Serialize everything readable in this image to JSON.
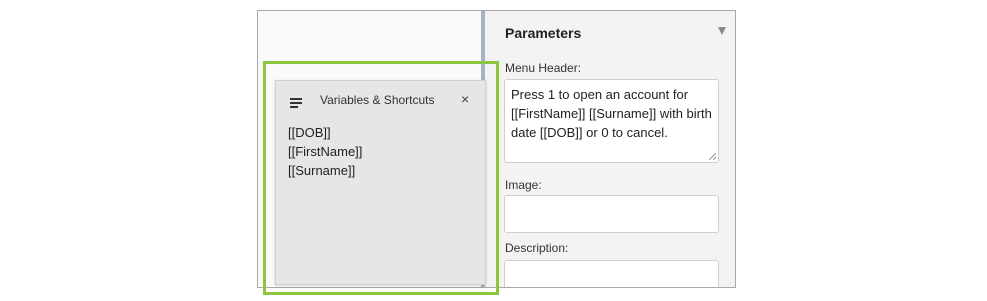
{
  "parameters": {
    "title": "Parameters",
    "menu_header_label": "Menu Header:",
    "menu_header_value": "Press 1 to open an account for [[FirstName]] [[Surname]] with birth date [[DOB]] or 0 to cancel.",
    "image_label": "Image:",
    "image_value": "",
    "description_label": "Description:",
    "description_value": ""
  },
  "variables_panel": {
    "title": "Variables & Shortcuts",
    "close_glyph": "×",
    "items": [
      "[[DOB]]",
      "[[FirstName]]",
      "[[Surname]]"
    ]
  },
  "colors": {
    "highlight": "#8cc63f",
    "splitter": "#a7b2c5",
    "panel_bg": "#e6e6e6"
  }
}
